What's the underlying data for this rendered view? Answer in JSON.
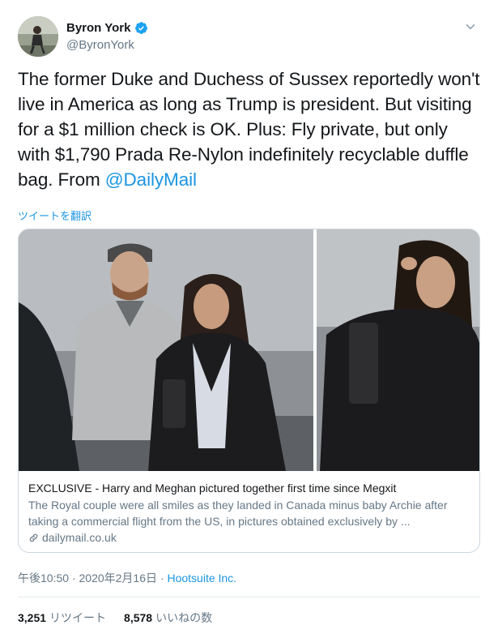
{
  "user": {
    "display_name": "Byron York",
    "handle": "@ByronYork",
    "verified": true
  },
  "tweet": {
    "text_main": "The former Duke and Duchess of Sussex reportedly won't live in America as long as Trump is president. But visiting for a $1 million check is OK. Plus: Fly private, but only with $1,790 Prada Re-Nylon indefinitely recyclable duffle bag. From ",
    "mention": "@DailyMail",
    "translate_link": "ツイートを翻訳"
  },
  "card": {
    "title": "EXCLUSIVE - Harry and Meghan pictured together first time since Megxit",
    "description": "The Royal couple were all smiles as they landed in Canada minus baby Archie after taking a commercial flight from the US, in pictures obtained exclusively by ...",
    "domain": "dailymail.co.uk"
  },
  "meta": {
    "time": "午後10:50",
    "separator": "·",
    "date": "2020年2月16日",
    "source": "Hootsuite Inc."
  },
  "stats": {
    "retweets_count": "3,251",
    "retweets_label": "リツイート",
    "likes_count": "8,578",
    "likes_label": "いいねの数"
  },
  "colors": {
    "accent": "#1b95e0",
    "secondary_text": "#657786",
    "border": "#ccd6dd"
  },
  "icons": [
    "verified-badge-icon",
    "chevron-down-icon",
    "link-icon"
  ]
}
